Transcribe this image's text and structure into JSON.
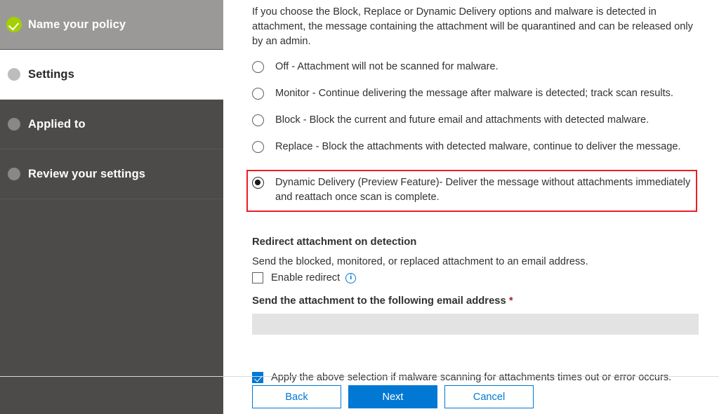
{
  "sidebar": {
    "items": [
      {
        "label": "Name your policy",
        "state": "done",
        "icon": "check-circle-icon"
      },
      {
        "label": "Settings",
        "state": "active",
        "icon": "step-dot-icon"
      },
      {
        "label": "Applied to",
        "state": "todo",
        "icon": "step-dot-icon"
      },
      {
        "label": "Review your settings",
        "state": "todo",
        "icon": "step-dot-icon"
      }
    ]
  },
  "main": {
    "intro": "If you choose the Block, Replace or Dynamic Delivery options and malware is detected in attachment, the message containing the attachment will be quarantined and can be released only by an admin.",
    "radio_options": [
      {
        "label": "Off - Attachment will not be scanned for malware.",
        "selected": false
      },
      {
        "label": "Monitor - Continue delivering the message after malware is detected; track scan results.",
        "selected": false
      },
      {
        "label": "Block - Block the current and future email and attachments with detected malware.",
        "selected": false
      },
      {
        "label": "Replace - Block the attachments with detected malware, continue to deliver the message.",
        "selected": false
      },
      {
        "label": "Dynamic Delivery (Preview Feature)- Deliver the message without attachments immediately and reattach once scan is complete.",
        "selected": true
      }
    ],
    "redirect_section": {
      "heading": "Redirect attachment on detection",
      "description": "Send the blocked, monitored, or replaced attachment to an email address.",
      "enable_redirect_label": "Enable redirect",
      "enable_redirect_checked": false,
      "info_icon_glyph": "i",
      "email_field_label": "Send the attachment to the following email address",
      "required_marker": "*",
      "email_field_value": "",
      "email_field_placeholder": ""
    },
    "timeout_checkbox": {
      "label": "Apply the above selection if malware scanning for attachments times out or error occurs.",
      "checked": true
    }
  },
  "footer": {
    "back_label": "Back",
    "next_label": "Next",
    "cancel_label": "Cancel"
  },
  "colors": {
    "accent_blue": "#0078d4",
    "highlight_red": "#ee1c25",
    "done_green": "#a4cf00",
    "sidebar_dark": "#4d4b49",
    "sidebar_done": "#9b9997",
    "required_red": "#a4262c"
  }
}
